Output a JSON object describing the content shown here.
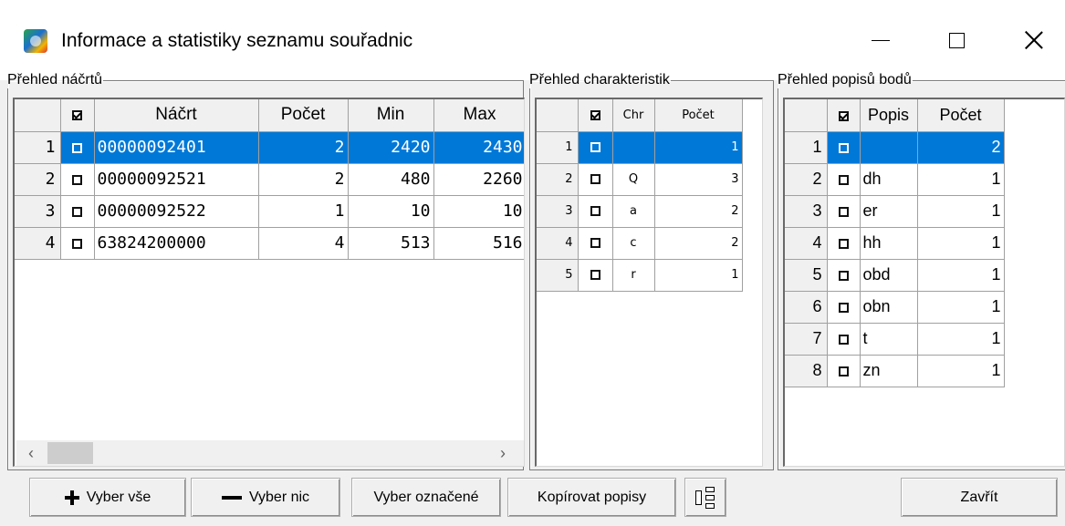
{
  "window": {
    "title": "Informace a statistiky seznamu souřadnic",
    "icon": "app-globe-icon"
  },
  "sketch_panel": {
    "legend": "Přehled náčrtů",
    "columns": [
      "☑",
      "Náčrt",
      "Počet",
      "Min",
      "Max"
    ],
    "rows": [
      {
        "n": "1",
        "sketch": "00000092401",
        "count": "2",
        "min": "2420",
        "max": "2430",
        "selected": true
      },
      {
        "n": "2",
        "sketch": "00000092521",
        "count": "2",
        "min": "480",
        "max": "2260",
        "selected": false
      },
      {
        "n": "3",
        "sketch": "00000092522",
        "count": "1",
        "min": "10",
        "max": "10",
        "selected": false
      },
      {
        "n": "4",
        "sketch": "63824200000",
        "count": "4",
        "min": "513",
        "max": "516",
        "selected": false
      }
    ]
  },
  "char_panel": {
    "legend": "Přehled charakteristik",
    "columns": [
      "☑",
      "Chr",
      "Počet"
    ],
    "rows": [
      {
        "n": "1",
        "chr": "",
        "count": "1",
        "selected": true
      },
      {
        "n": "2",
        "chr": "Q",
        "count": "3",
        "selected": false
      },
      {
        "n": "3",
        "chr": "a",
        "count": "2",
        "selected": false
      },
      {
        "n": "4",
        "chr": "c",
        "count": "2",
        "selected": false
      },
      {
        "n": "5",
        "chr": "r",
        "count": "1",
        "selected": false
      }
    ]
  },
  "desc_panel": {
    "legend": "Přehled popisů bodů",
    "columns": [
      "☑",
      "Popis",
      "Počet"
    ],
    "rows": [
      {
        "n": "1",
        "desc": "",
        "count": "2",
        "selected": true
      },
      {
        "n": "2",
        "desc": "dh",
        "count": "1",
        "selected": false
      },
      {
        "n": "3",
        "desc": "er",
        "count": "1",
        "selected": false
      },
      {
        "n": "4",
        "desc": "hh",
        "count": "1",
        "selected": false
      },
      {
        "n": "5",
        "desc": "obd",
        "count": "1",
        "selected": false
      },
      {
        "n": "6",
        "desc": "obn",
        "count": "1",
        "selected": false
      },
      {
        "n": "7",
        "desc": "t",
        "count": "1",
        "selected": false
      },
      {
        "n": "8",
        "desc": "zn",
        "count": "1",
        "selected": false
      }
    ]
  },
  "buttons": {
    "select_all": "Vyber vše",
    "select_none": "Vyber nic",
    "select_marked": "Vyber označené",
    "copy_desc": "Kopírovat popisy",
    "close": "Zavřít"
  },
  "colors": {
    "selection": "#0078d7",
    "background": "#f0f0f0"
  }
}
